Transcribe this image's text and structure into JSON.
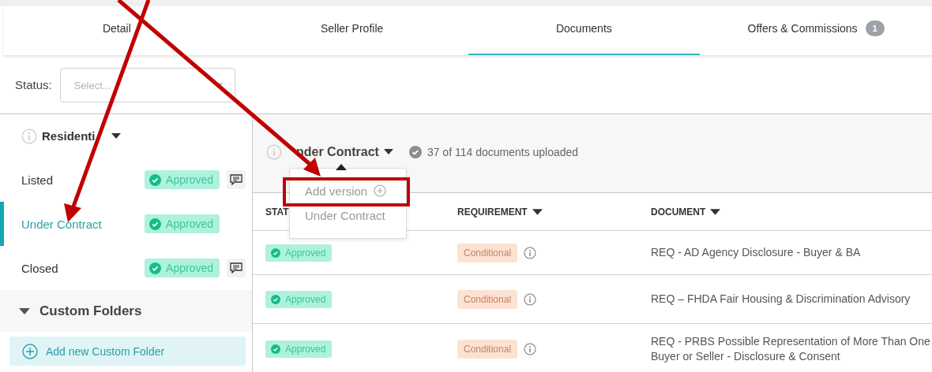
{
  "tabs": [
    {
      "label": "Detail",
      "selected": false
    },
    {
      "label": "Seller Profile",
      "selected": false
    },
    {
      "label": "Documents",
      "selected": true
    },
    {
      "label": "Offers & Commissions",
      "selected": false,
      "badge": "1"
    }
  ],
  "filter": {
    "label": "Status:",
    "placeholder": "Select..."
  },
  "sidebar": {
    "group": {
      "title": "Residenti"
    },
    "items": [
      {
        "label": "Listed",
        "status": "Approved",
        "comment": true,
        "selected": false
      },
      {
        "label": "Under Contract",
        "status": "Approved",
        "comment": false,
        "selected": true
      },
      {
        "label": "Closed",
        "status": "Approved",
        "comment": true,
        "selected": false
      }
    ],
    "custom_folders": {
      "title": "Custom Folders",
      "expanded": true
    },
    "add_button": "Add new Custom Folder"
  },
  "main": {
    "title": "nder Contract",
    "progress": "37 of 114 documents uploaded",
    "dropdown": {
      "items": [
        {
          "label": "Add version",
          "kind": "action"
        },
        {
          "label": "Under Contract",
          "kind": "option"
        }
      ]
    },
    "columns": [
      {
        "label": "STAT"
      },
      {
        "label": "REQUIREMENT",
        "sortable": true
      },
      {
        "label": "DOCUMENT",
        "sortable": true
      }
    ],
    "rows": [
      {
        "status": "Approved",
        "requirement": "Conditional",
        "document": "REQ - AD Agency Disclosure - Buyer & BA"
      },
      {
        "status": "Approved",
        "requirement": "Conditional",
        "document": "REQ – FHDA Fair Housing & Discrimination Advisory"
      },
      {
        "status": "Approved",
        "requirement": "Conditional",
        "document": "REQ - PRBS Possible Representation of More Than One Buyer or Seller - Disclosure & Consent"
      }
    ]
  }
}
